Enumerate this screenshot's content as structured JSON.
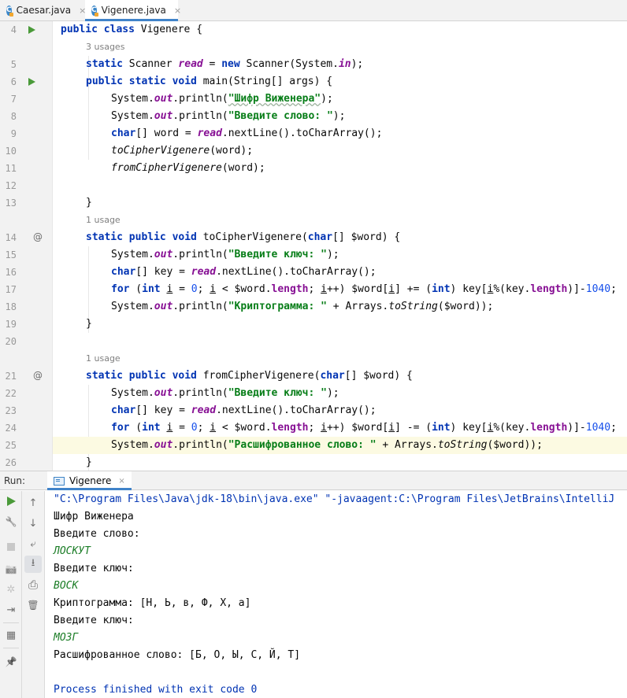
{
  "tabs": [
    {
      "label": "Caesar.java",
      "active": false
    },
    {
      "label": "Vigenere.java",
      "active": true
    }
  ],
  "editor": {
    "usages": [
      "3 usages",
      "1 usage",
      "1 usage"
    ],
    "line_numbers": [
      "4",
      "5",
      "6",
      "7",
      "8",
      "9",
      "10",
      "11",
      "12",
      "13",
      "14",
      "15",
      "16",
      "17",
      "18",
      "19",
      "20",
      "21",
      "22",
      "23",
      "24",
      "25",
      "26"
    ],
    "current_line": "25",
    "code": {
      "l4": {
        "k1": "public class",
        "t1": " Vigenere {"
      },
      "l5": {
        "k1": "static",
        "t1": " Scanner ",
        "f1": "read",
        "t2": " = ",
        "k2": "new",
        "t3": " Scanner(System.",
        "f2": "in",
        "t4": ");"
      },
      "l6": {
        "k1": "public static void",
        "t1": " main(String[] args) {"
      },
      "l7": {
        "t1": "System.",
        "f1": "out",
        "t2": ".println(",
        "s1": "\"Шифр Виженера\"",
        "t3": ");"
      },
      "l8": {
        "t1": "System.",
        "f1": "out",
        "t2": ".println(",
        "s1": "\"Введите слово: \"",
        "t3": ");"
      },
      "l9": {
        "k1": "char",
        "t1": "[] word = ",
        "f1": "read",
        "t2": ".nextLine().toCharArray();"
      },
      "l10": {
        "m1": "toCipherVigenere",
        "t1": "(word);"
      },
      "l11": {
        "m1": "fromCipherVigenere",
        "t1": "(word);"
      },
      "l13": {
        "t1": "}"
      },
      "l14": {
        "k1": "static public void",
        "t1": " toCipherVigenere(",
        "k2": "char",
        "t2": "[] $word) {"
      },
      "l15": {
        "t1": "System.",
        "f1": "out",
        "t2": ".println(",
        "s1": "\"Введите ключ: \"",
        "t3": ");"
      },
      "l16": {
        "k1": "char",
        "t1": "[] key = ",
        "f1": "read",
        "t2": ".nextLine().toCharArray();"
      },
      "l17": {
        "k1": "for",
        "t1": " (",
        "k2": "int",
        "t2": " ",
        "u1": "i",
        "t3": " = ",
        "n1": "0",
        "t4": "; ",
        "u2": "i",
        "t5": " < $word.",
        "fl1": "length",
        "t6": "; ",
        "u3": "i",
        "t7": "++) $word[",
        "u4": "i",
        "t8": "] += (",
        "k3": "int",
        "t9": ") key[",
        "u5": "i",
        "t10": "%(key.",
        "fl2": "length",
        "t11": ")]-",
        "n2": "1040",
        "t12": ";"
      },
      "l18": {
        "t1": "System.",
        "f1": "out",
        "t2": ".println(",
        "s1": "\"Криптограмма: \"",
        "t3": " + Arrays.",
        "m1": "toString",
        "t4": "($word));"
      },
      "l19": {
        "t1": "}"
      },
      "l21": {
        "k1": "static public void",
        "t1": " fromCipherVigenere(",
        "k2": "char",
        "t2": "[] $word) {"
      },
      "l22": {
        "t1": "System.",
        "f1": "out",
        "t2": ".println(",
        "s1": "\"Введите ключ: \"",
        "t3": ");"
      },
      "l23": {
        "k1": "char",
        "t1": "[] key = ",
        "f1": "read",
        "t2": ".nextLine().toCharArray();"
      },
      "l24": {
        "k1": "for",
        "t1": " (",
        "k2": "int",
        "t2": " ",
        "u1": "i",
        "t3": " = ",
        "n1": "0",
        "t4": "; ",
        "u2": "i",
        "t5": " < $word.",
        "fl1": "length",
        "t6": "; ",
        "u3": "i",
        "t7": "++) $word[",
        "u4": "i",
        "t8": "] -= (",
        "k3": "int",
        "t9": ") key[",
        "u5": "i",
        "t10": "%(key.",
        "fl2": "length",
        "t11": ")]-",
        "n2": "1040",
        "t12": ";"
      },
      "l25": {
        "t1": "System.",
        "f1": "out",
        "t2": ".println(",
        "s1": "\"Расшифрованное слово: \"",
        "t3": " + Arrays.",
        "m1": "toString",
        "t4": "($word));"
      },
      "l26": {
        "t1": "}"
      }
    }
  },
  "run_panel": {
    "label": "Run:",
    "tab_label": "Vigenere",
    "console": [
      {
        "text": "\"C:\\Program Files\\Java\\jdk-18\\bin\\java.exe\" \"-javaagent:C:\\Program Files\\JetBrains\\IntelliJ",
        "kind": "cmd"
      },
      {
        "text": "Шифр Виженера",
        "kind": "out"
      },
      {
        "text": "Введите слово:",
        "kind": "out"
      },
      {
        "text": "ЛОСКУТ",
        "kind": "in"
      },
      {
        "text": "Введите ключ:",
        "kind": "out"
      },
      {
        "text": "ВОСК",
        "kind": "in"
      },
      {
        "text": "Криптограмма: [Н, Ь, в, Ф, Х, а]",
        "kind": "out"
      },
      {
        "text": "Введите ключ:",
        "kind": "out"
      },
      {
        "text": "МОЗГ",
        "kind": "in"
      },
      {
        "text": "Расшифрованное слово: [Б, О, Ы, С, Й, Т]",
        "kind": "out"
      },
      {
        "text": "",
        "kind": "out"
      },
      {
        "text": "Process finished with exit code 0",
        "kind": "fin"
      }
    ]
  },
  "icons": {
    "file_icon": "java-class-icon",
    "close": "×",
    "override": "@",
    "arrow_up": "↑",
    "arrow_down": "↓",
    "soft_wrap": "⤶",
    "scroll_end": "⭳",
    "print": "⎙",
    "trash": "🗑",
    "wrench": "🔧",
    "camera": "📷",
    "bug": "✲",
    "exit": "⇥",
    "layout": "▦",
    "pin": "📌"
  },
  "colors": {
    "keyword": "#0033b3",
    "string": "#067d17",
    "field": "#871094",
    "number": "#1750eb",
    "run_green": "#4a9a39",
    "current_line_bg": "#fcfae2",
    "tab_accent": "#4083c9"
  }
}
